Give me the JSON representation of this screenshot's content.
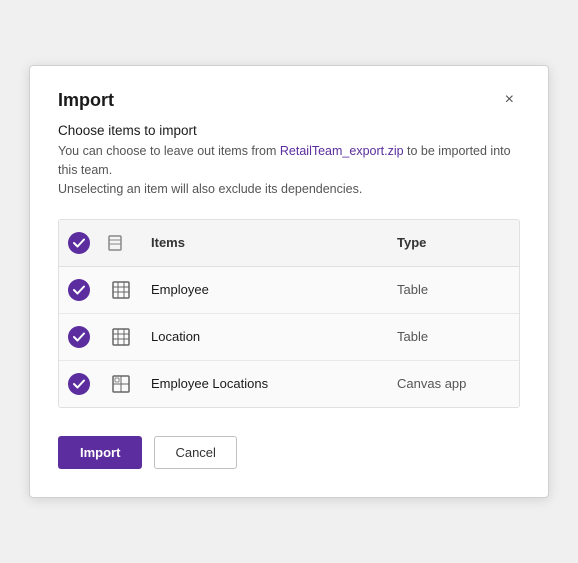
{
  "dialog": {
    "title": "Import",
    "subtitle": "Choose items to import",
    "description_prefix": "You can choose to leave out items from ",
    "filename": "RetailTeam_export.zip",
    "description_suffix": " to be imported into this team.",
    "description_line2": "Unselecting an item will also exclude its dependencies.",
    "close_label": "×"
  },
  "table": {
    "columns": [
      {
        "id": "check",
        "label": ""
      },
      {
        "id": "icon",
        "label": ""
      },
      {
        "id": "items",
        "label": "Items"
      },
      {
        "id": "type",
        "label": "Type"
      }
    ],
    "rows": [
      {
        "checked": true,
        "icon": "table-icon",
        "name": "Employee",
        "type": "Table"
      },
      {
        "checked": true,
        "icon": "table-icon",
        "name": "Location",
        "type": "Table"
      },
      {
        "checked": true,
        "icon": "canvas-icon",
        "name": "Employee Locations",
        "type": "Canvas app"
      }
    ]
  },
  "footer": {
    "import_label": "Import",
    "cancel_label": "Cancel"
  },
  "colors": {
    "accent": "#5b2d9e",
    "header_bg": "#f5f5f5",
    "row_bg": "#fafafa"
  }
}
